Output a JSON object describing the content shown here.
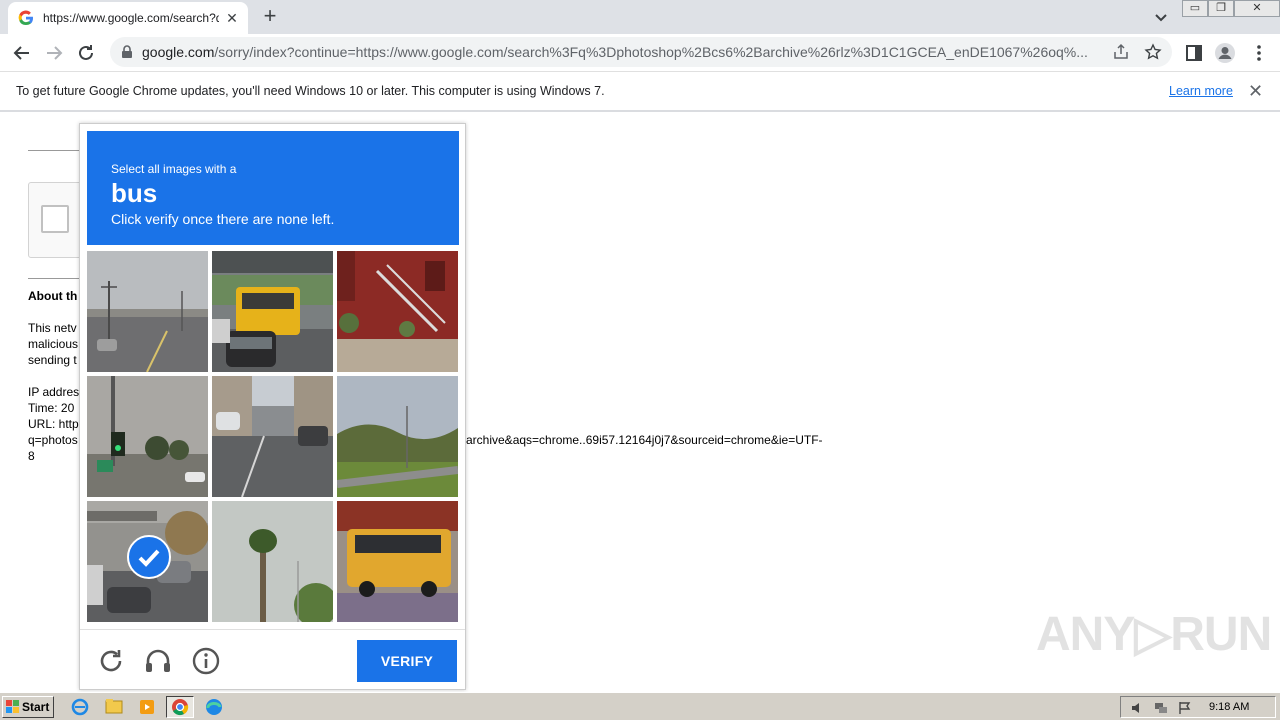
{
  "browser": {
    "tab_title": "https://www.google.com/search?q=",
    "tab_close": "✕",
    "new_tab": "+",
    "url_domain": "google.com",
    "url_rest": "/sorry/index?continue=https://www.google.com/search%3Fq%3Dphotoshop%2Bcs6%2Barchive%26rlz%3D1C1GCEA_enDE1067%26oq%...",
    "window_buttons": [
      "▭",
      "❐",
      "✕"
    ]
  },
  "infobar": {
    "message": "To get future Google Chrome updates, you'll need Windows 10 or later. This computer is using Windows 7.",
    "learn_more": "Learn more",
    "close": "✕"
  },
  "page": {
    "about_heading": "About th",
    "para_lines": [
      "This netv",
      "malicious",
      "sending t"
    ],
    "ip_line": "IP addres",
    "time_line": "Time: 20",
    "url_line": "URL: http",
    "url_q": "q=photos",
    "url_tail": "archive&aqs=chrome..69i57.12164j0j7&sourceid=chrome&ie=UTF-",
    "url_end": "8"
  },
  "challenge": {
    "instruction": "Select all images with a",
    "target": "bus",
    "hint": "Click verify once there are none left.",
    "verify_label": "VERIFY",
    "tiles": [
      {
        "desc": "street",
        "selected": false
      },
      {
        "desc": "school-bus-rear",
        "selected": false
      },
      {
        "desc": "stairs",
        "selected": false
      },
      {
        "desc": "traffic-light",
        "selected": false
      },
      {
        "desc": "street-cars",
        "selected": false
      },
      {
        "desc": "road-trees",
        "selected": false
      },
      {
        "desc": "street-bridge",
        "selected": true
      },
      {
        "desc": "palm-tree",
        "selected": false
      },
      {
        "desc": "school-bus",
        "selected": false
      }
    ]
  },
  "watermark": "ANY▷RUN",
  "taskbar": {
    "start": "Start",
    "clock": "9:18 AM"
  },
  "colors": {
    "accent": "#1a73e8",
    "tabstrip": "#dee1e6",
    "taskbar": "#d4d0c8"
  }
}
